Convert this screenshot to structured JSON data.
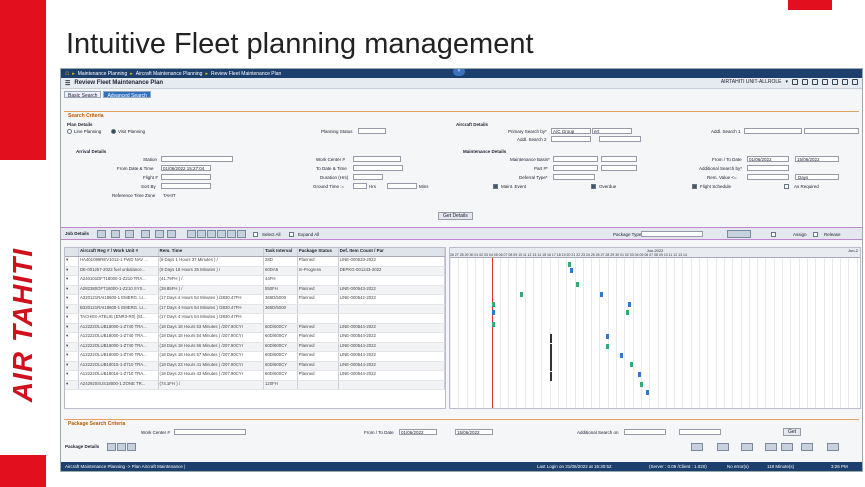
{
  "slide_title": "Intuitive Fleet planning management",
  "brand": "AIR TAHITI",
  "nav": {
    "items": [
      "Maintenance Planning",
      "Aircraft Maintenance Planning",
      "Review Fleet Maintenance Plan"
    ]
  },
  "header": {
    "title": "Review Fleet Maintenance Plan",
    "user": "AIRTAHITI UNIT-ALLROLE"
  },
  "tabs": [
    "Basic Search",
    "Advanced Search"
  ],
  "search": {
    "section": "Search Criteria",
    "plan_details": "Plan Details",
    "line_planning": "Line Planning",
    "visit_planning": "Visit Planning",
    "planning_status": "Planning Status",
    "aircraft_details": "Aircraft Details",
    "primary_search_by": "Primary Search by*",
    "primary_value": "A/C Group",
    "primary_text": "ert",
    "addl_search1": "Addl. Search 1",
    "addl_search2": "Addl. Search 2",
    "arrival_details": "Arrival Details",
    "station": "Station",
    "from_date_time": "From Date & Time",
    "from_date_value": "01/06/2022 15:27:04",
    "flight_no": "Flight #",
    "sort_by": "Sort By",
    "ref_tz": "Reference Time Zone",
    "ref_tz_value": "TAHIT",
    "work_center": "Work Center #",
    "to_date_time": "To Date & Time",
    "duration": "Duration (Hrs)",
    "ground_time": "Ground Time :=",
    "hrs": "Hrs",
    "mins": "Mins",
    "maint_details": "Maintenance Details",
    "maint_basis": "Maintenance Basis*",
    "part_no": "Part #*",
    "deferral_type": "Deferral Type*",
    "maint_event": "Maint. Event",
    "overdue": "Overdue",
    "from_to_date": "From / To Date",
    "from_date": "01/06/2022",
    "to_date": "15/06/2022",
    "addl_search_by": "Additional Search by*",
    "rem_value": "Rem. Value <=",
    "days": "Days",
    "flight_schedule": "Flight Schedule",
    "as_required": "As Required",
    "get_details": "Get Details"
  },
  "job": {
    "label": "Job Details",
    "select_all": "Select All",
    "expand_all": "Expand All",
    "package_type": "Package Type",
    "assign": "Assign",
    "release": "Release"
  },
  "grid": {
    "headers": [
      "",
      "Aircraft Reg # / Work Unit #",
      "Rem. Time",
      "Task Interval",
      "Package Status",
      "Def. Item Count / Par"
    ],
    "rows": [
      [
        "▾",
        "HA401099REV1012-1 FWD NAV ...",
        "(9 Days 1 Hours 37 Minutes ) /",
        "28D",
        "Planned",
        "LINE-000533-2022"
      ],
      [
        "▾",
        "DE-001257-2022 fuel unbalance...",
        "(9 Days 18 Hours 35 Minutes ) /",
        "60DA5",
        "In-Progress",
        "DEPKG-001243-2022"
      ],
      [
        "▾",
        "A240101DFT18000-1-Z210 TRA...",
        "(41.79FH ) /",
        "44FH",
        "",
        ""
      ],
      [
        "▾",
        "A282380OFT18000-1-Z210 SYS...",
        "(39.85FH ) /",
        "550FH",
        "Planned",
        "LINE-000543-2022"
      ],
      [
        "▾",
        "A320121RAI18600-1 EMERG. LI...",
        "(17 Days 4 Hours 54 Minutes ) /3830.47FH",
        "365D/5000",
        "Planned",
        "LINE-000542-2022"
      ],
      [
        "▾",
        "B320121RAI18600-1 EMERG. LI...",
        "(17 Days 4 Hours 54 Minutes ) /3830.47FH",
        "365D/5000",
        "",
        ""
      ],
      [
        "▾",
        "TACHES-ATELIE (ENR3-R0) (St...",
        "(17 Days 4 Hours 54 Minutes ) /3830.47FH",
        "",
        "",
        ""
      ],
      [
        "▾",
        "A12222OLUB18000-1-Z740 TRA...",
        "(18 Days 18 Hours 53 Minutes ) /207.90CYI",
        "60D/600CY",
        "Planned",
        "LINE-000544-2022"
      ],
      [
        "▾",
        "A12222OLUB18000-1-Z740 TRA...",
        "(18 Days 18 Hours 54 Minutes ) /207.90CYI",
        "60D/600CY",
        "Planned",
        "LINE-000544-2022"
      ],
      [
        "▾",
        "A12222OLUB18000-1-Z740 TRA...",
        "(18 Days 18 Hours 56 Minutes ) /207.90CYI",
        "60D/600CY",
        "Planned",
        "LINE-000544-2022"
      ],
      [
        "▾",
        "A12222OLUB18000-1-Z740 TRA...",
        "(18 Days 18 Hours 57 Minutes ) /207.90CYI",
        "60D/600CY",
        "Planned",
        "LINE-000544-2022"
      ],
      [
        "▾",
        "A12222OLUB18015-1-Z710 TRA...",
        "(18 Days 23 Hours 41 Minutes ) /207.90CYI",
        "60D/600CY",
        "Planned",
        "LINE-000544-2022"
      ],
      [
        "▾",
        "A12222OLUB18016-1-Z710 TRA...",
        "(18 Days 23 Hours 43 Minutes ) /207.90CYI",
        "60D/600CY",
        "Planned",
        "LINE-000544-2022"
      ],
      [
        "▾",
        "A242920SUS18000-1 ZONE TR...",
        "(74.1FH ) /",
        "120FH",
        "",
        ""
      ]
    ]
  },
  "gantt": {
    "month": "Jun-2022",
    "month2": "Jun-2",
    "days": "26 27 28 29 30 01 02 03 04 05 06 07 08 09 10 11 12 13 14 15 16 17 18 19 20 21 22 23 24 25 26 27 28 29 30 01 02 03 04 05 06 07 08 09 10 11 12 13 14"
  },
  "package": {
    "section": "Package Search Criteria",
    "work_center": "Work Center #",
    "from_to_date": "From / To Date",
    "from_date": "01/06/2022",
    "to_date": "15/06/2022",
    "addl_search": "Additional Search on",
    "get": "Get",
    "details": "Package Details"
  },
  "status": {
    "path": "Aircraft Maintenance Planning -> Plan Aircraft Maintenance |",
    "last_login": "Last Login on 31/05/2022 at 16:30:52",
    "server": "(Server : 0.09 /Client : 1.020)",
    "no_errors": "No error(s)",
    "time_left": "118 Minute(s)",
    "clock": "3:26 PM"
  }
}
